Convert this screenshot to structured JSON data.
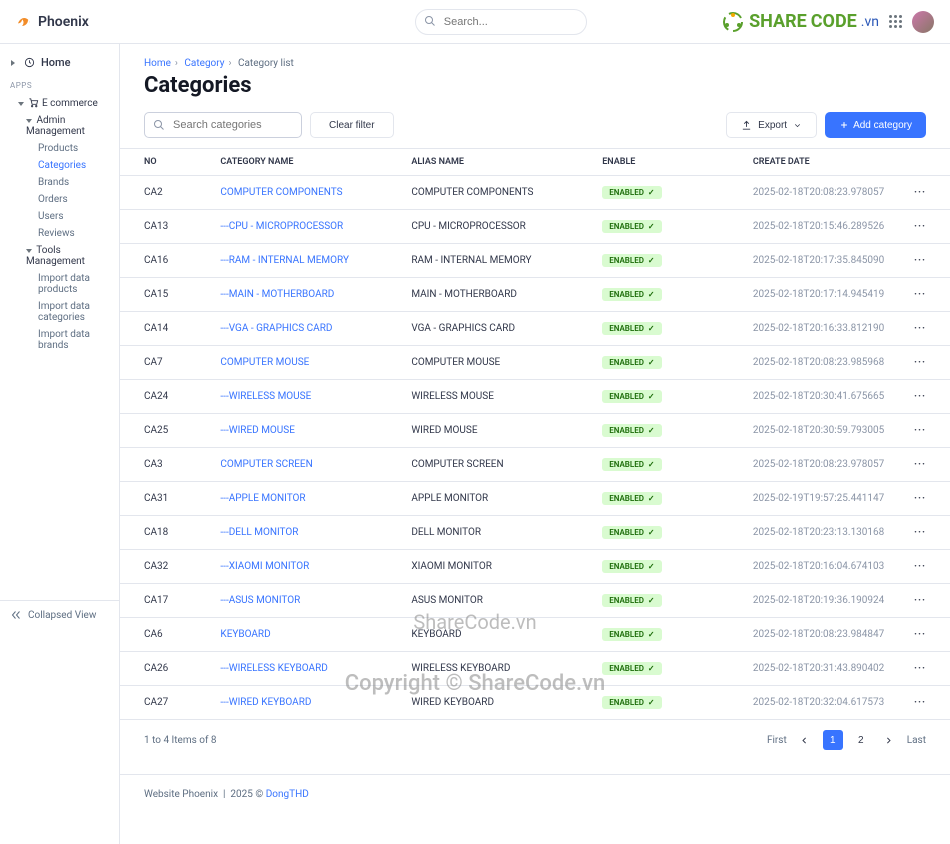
{
  "brand": "Phoenix",
  "search_placeholder": "Search...",
  "sharecode": {
    "a": "SHARE",
    "b": "CODE",
    "suffix": ".vn"
  },
  "sidebar": {
    "home": "Home",
    "apps_label": "APPS",
    "ecom": "E commerce",
    "admin": "Admin Management",
    "admin_items": [
      "Products",
      "Categories",
      "Brands",
      "Orders",
      "Users",
      "Reviews"
    ],
    "tools": "Tools Management",
    "tools_items": [
      "Import data products",
      "Import data categories",
      "Import data brands"
    ],
    "collapse": "Collapsed View"
  },
  "breadcrumbs": {
    "home": "Home",
    "category": "Category",
    "list": "Category list"
  },
  "page_title": "Categories",
  "toolbar": {
    "search_placeholder": "Search categories",
    "clear": "Clear filter",
    "export": "Export",
    "add": "Add category"
  },
  "columns": {
    "no": "NO",
    "name": "CATEGORY NAME",
    "alias": "ALIAS NAME",
    "enable": "ENABLE",
    "date": "CREATE DATE"
  },
  "enabled_label": "ENABLED",
  "rows": [
    {
      "no": "CA2",
      "name": "COMPUTER COMPONENTS",
      "alias": "COMPUTER COMPONENTS",
      "date": "2025-02-18T20:08:23.978057",
      "indent": false
    },
    {
      "no": "CA13",
      "name": "---CPU - MICROPROCESSOR",
      "alias": "CPU - MICROPROCESSOR",
      "date": "2025-02-18T20:15:46.289526",
      "indent": true
    },
    {
      "no": "CA16",
      "name": "---RAM - INTERNAL MEMORY",
      "alias": "RAM - INTERNAL MEMORY",
      "date": "2025-02-18T20:17:35.845090",
      "indent": true
    },
    {
      "no": "CA15",
      "name": "---MAIN - MOTHERBOARD",
      "alias": "MAIN - MOTHERBOARD",
      "date": "2025-02-18T20:17:14.945419",
      "indent": true
    },
    {
      "no": "CA14",
      "name": "---VGA - GRAPHICS CARD",
      "alias": "VGA - GRAPHICS CARD",
      "date": "2025-02-18T20:16:33.812190",
      "indent": true
    },
    {
      "no": "CA7",
      "name": "COMPUTER MOUSE",
      "alias": "COMPUTER MOUSE",
      "date": "2025-02-18T20:08:23.985968",
      "indent": false
    },
    {
      "no": "CA24",
      "name": "---WIRELESS MOUSE",
      "alias": "WIRELESS MOUSE",
      "date": "2025-02-18T20:30:41.675665",
      "indent": true
    },
    {
      "no": "CA25",
      "name": "---WIRED MOUSE",
      "alias": "WIRED MOUSE",
      "date": "2025-02-18T20:30:59.793005",
      "indent": true
    },
    {
      "no": "CA3",
      "name": "COMPUTER SCREEN",
      "alias": "COMPUTER SCREEN",
      "date": "2025-02-18T20:08:23.978057",
      "indent": false
    },
    {
      "no": "CA31",
      "name": "---APPLE MONITOR",
      "alias": "APPLE MONITOR",
      "date": "2025-02-19T19:57:25.441147",
      "indent": true
    },
    {
      "no": "CA18",
      "name": "---DELL MONITOR",
      "alias": "DELL MONITOR",
      "date": "2025-02-18T20:23:13.130168",
      "indent": true
    },
    {
      "no": "CA32",
      "name": "---XIAOMI MONITOR",
      "alias": "XIAOMI MONITOR",
      "date": "2025-02-18T20:16:04.674103",
      "indent": true
    },
    {
      "no": "CA17",
      "name": "---ASUS MONITOR",
      "alias": "ASUS MONITOR",
      "date": "2025-02-18T20:19:36.190924",
      "indent": true
    },
    {
      "no": "CA6",
      "name": "KEYBOARD",
      "alias": "KEYBOARD",
      "date": "2025-02-18T20:08:23.984847",
      "indent": false
    },
    {
      "no": "CA26",
      "name": "---WIRELESS KEYBOARD",
      "alias": "WIRELESS KEYBOARD",
      "date": "2025-02-18T20:31:43.890402",
      "indent": true
    },
    {
      "no": "CA27",
      "name": "---WIRED KEYBOARD",
      "alias": "WIRED KEYBOARD",
      "date": "2025-02-18T20:32:04.617573",
      "indent": true
    }
  ],
  "pagination": {
    "info": "1 to 4 Items of 8",
    "first": "First",
    "last": "Last",
    "p1": "1",
    "p2": "2"
  },
  "footer": {
    "site": "Website Phoenix",
    "sep": "|",
    "year": "2025 ©",
    "author": "DongTHD"
  },
  "watermark": "ShareCode.vn",
  "watermark2": "Copyright © ShareCode.vn"
}
